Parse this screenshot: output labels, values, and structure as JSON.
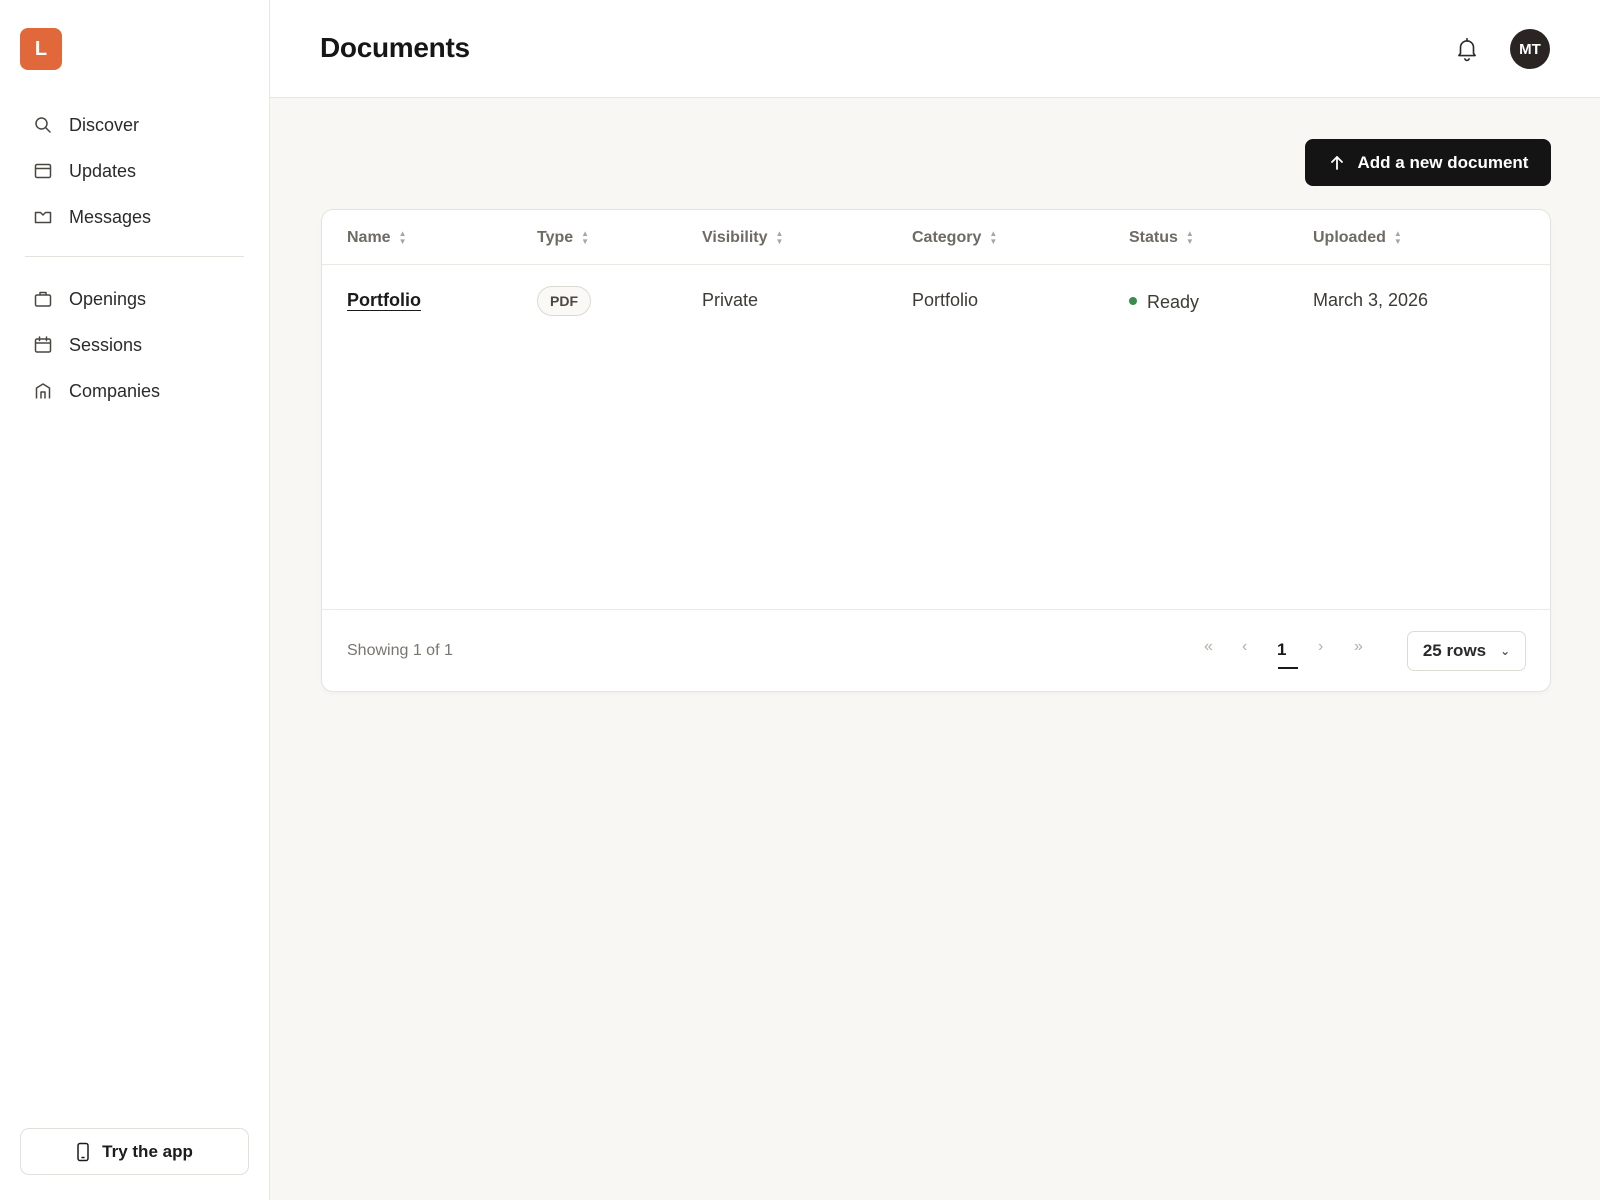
{
  "logo": {
    "letter": "L",
    "color": "#e0683b"
  },
  "sidebar": {
    "primary": [
      {
        "label": "Discover",
        "icon": "search-icon"
      },
      {
        "label": "Updates",
        "icon": "window-icon"
      },
      {
        "label": "Messages",
        "icon": "envelope-icon"
      }
    ],
    "secondary": [
      {
        "label": "Openings",
        "icon": "briefcase-icon"
      },
      {
        "label": "Sessions",
        "icon": "calendar-icon"
      },
      {
        "label": "Companies",
        "icon": "building-icon"
      }
    ],
    "try_app_label": "Try the app"
  },
  "header": {
    "title": "Documents",
    "avatar_initials": "MT"
  },
  "actions": {
    "add_document_label": "Add a new document"
  },
  "table": {
    "columns": [
      "Name",
      "Type",
      "Visibility",
      "Category",
      "Status",
      "Uploaded"
    ],
    "rows": [
      {
        "name": "Portfolio",
        "type": "PDF",
        "visibility": "Private",
        "category": "Portfolio",
        "status": "Ready",
        "uploaded": "March 3, 2026"
      }
    ],
    "status_color": "#3a8d4d"
  },
  "footer": {
    "showing": "Showing 1 of 1",
    "current_page": "1",
    "rows_per_page": "25 rows"
  }
}
